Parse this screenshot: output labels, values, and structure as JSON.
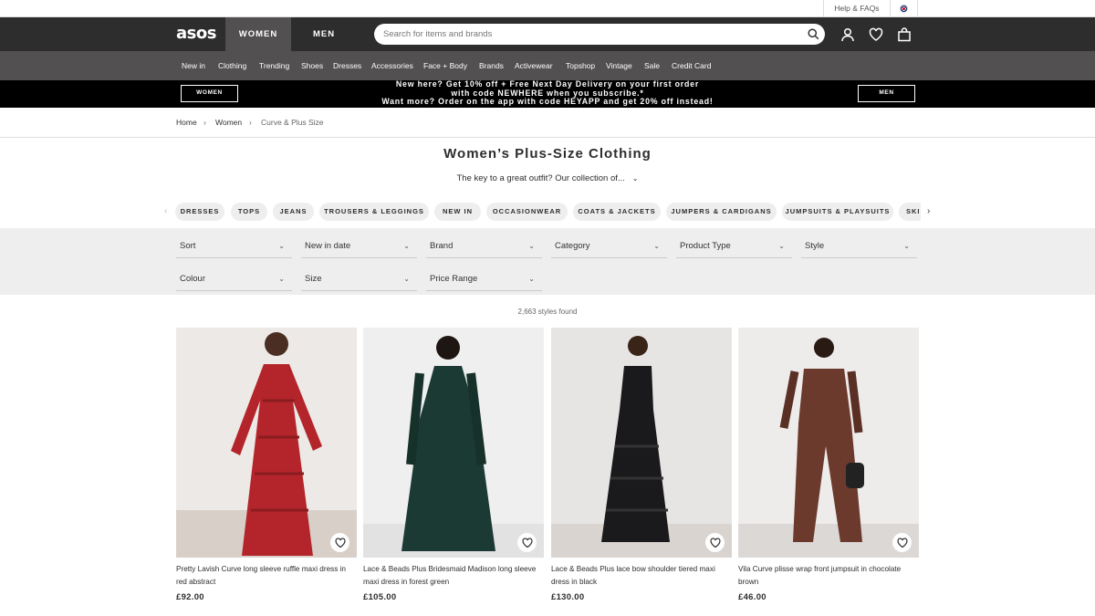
{
  "utility": {
    "help": "Help & FAQs",
    "flag_icon": "uk-flag-icon"
  },
  "header": {
    "logo": "asos",
    "tabs": [
      "WOMEN",
      "MEN"
    ],
    "search_placeholder": "Search for items and brands",
    "icons": [
      "search-icon",
      "account-icon",
      "heart-icon",
      "bag-icon"
    ]
  },
  "nav": [
    "New in",
    "Clothing",
    "Trending",
    "Shoes",
    "Dresses",
    "Accessories",
    "Face + Body",
    "Brands",
    "Activewear",
    "Topshop",
    "Vintage",
    "Sale",
    "Credit Card"
  ],
  "promo": {
    "left": "WOMEN",
    "right": "MEN",
    "line1": "New here? Get 10% off + Free Next Day Delivery on your first order",
    "line2": "with code NEWHERE when you subscribe.*",
    "line3": "Want more? Order on the app with code HEYAPP and get 20% off instead!"
  },
  "breadcrumb": [
    "Home",
    "Women",
    "Curve & Plus Size"
  ],
  "page": {
    "title": "Women’s Plus-Size Clothing",
    "subtitle": "The key to a great outfit? Our collection of..."
  },
  "pills": [
    "DRESSES",
    "TOPS",
    "JEANS",
    "TROUSERS & LEGGINGS",
    "NEW IN",
    "OCCASIONWEAR",
    "COATS & JACKETS",
    "JUMPERS & CARDIGANS",
    "JUMPSUITS & PLAYSUITS",
    "SKIRTS"
  ],
  "filters": [
    "Sort",
    "New in date",
    "Brand",
    "Category",
    "Product Type",
    "Style",
    "Colour",
    "Size",
    "Price Range"
  ],
  "results_count": "2,663 styles found",
  "products": [
    {
      "name": "Pretty Lavish Curve long sleeve ruffle maxi dress in red abstract",
      "price": "£92.00",
      "color": "#b3252a"
    },
    {
      "name": "Lace & Beads Plus Bridesmaid Madison long sleeve maxi dress in forest green",
      "price": "£105.00",
      "color": "#1b3a33"
    },
    {
      "name": "Lace & Beads Plus lace bow shoulder tiered maxi dress in black",
      "price": "£130.00",
      "color": "#1a1a1c"
    },
    {
      "name": "Vila Curve plisse wrap front jumpsuit in chocolate brown",
      "price": "£46.00",
      "color": "#6b3a2c"
    }
  ]
}
